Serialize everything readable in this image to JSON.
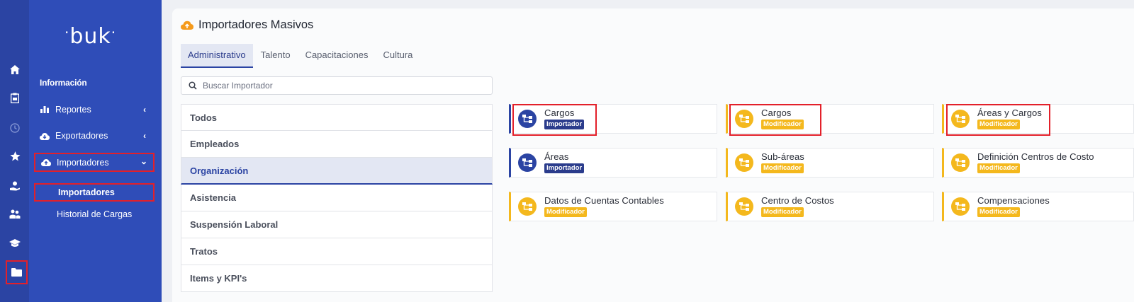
{
  "brand": {
    "logo_text": "buk"
  },
  "rail": {
    "icons": [
      "home-icon",
      "clipboard-icon",
      "clock-icon",
      "star-icon",
      "user-hand-icon",
      "team-icon",
      "graduation-cap-icon",
      "folder-icon"
    ]
  },
  "sidebar": {
    "section_title": "Información",
    "items": [
      {
        "label": "Reportes"
      },
      {
        "label": "Exportadores"
      },
      {
        "label": "Importadores"
      }
    ],
    "sub_items": [
      {
        "label": "Importadores"
      },
      {
        "label": "Historial de Cargas"
      }
    ]
  },
  "main": {
    "title": "Importadores Masivos",
    "tabs": [
      {
        "label": "Administrativo"
      },
      {
        "label": "Talento"
      },
      {
        "label": "Capacitaciones"
      },
      {
        "label": "Cultura"
      }
    ],
    "search_placeholder": "Buscar Importador",
    "categories": [
      {
        "label": "Todos"
      },
      {
        "label": "Empleados"
      },
      {
        "label": "Organización"
      },
      {
        "label": "Asistencia"
      },
      {
        "label": "Suspensión Laboral"
      },
      {
        "label": "Tratos"
      },
      {
        "label": "Items y KPI's"
      }
    ],
    "cards": [
      {
        "name": "Cargos",
        "badge": "Importador"
      },
      {
        "name": "Cargos",
        "badge": "Modificador"
      },
      {
        "name": "Áreas y Cargos",
        "badge": "Modificador"
      },
      {
        "name": "Áreas",
        "badge": "Importador"
      },
      {
        "name": "Sub-áreas",
        "badge": "Modificador"
      },
      {
        "name": "Definición Centros de Costo",
        "badge": "Modificador"
      },
      {
        "name": "Datos de Cuentas Contables",
        "badge": "Modificador"
      },
      {
        "name": "Centro de Costos",
        "badge": "Modificador"
      },
      {
        "name": "Compensaciones",
        "badge": "Modificador"
      }
    ]
  },
  "colors": {
    "rail": "#2b44a3",
    "sidebar": "#2f4db8",
    "importador": "#2b44a3",
    "modificador": "#f4b81d",
    "highlight": "#e3202a",
    "title_icon": "#f59a1b"
  }
}
